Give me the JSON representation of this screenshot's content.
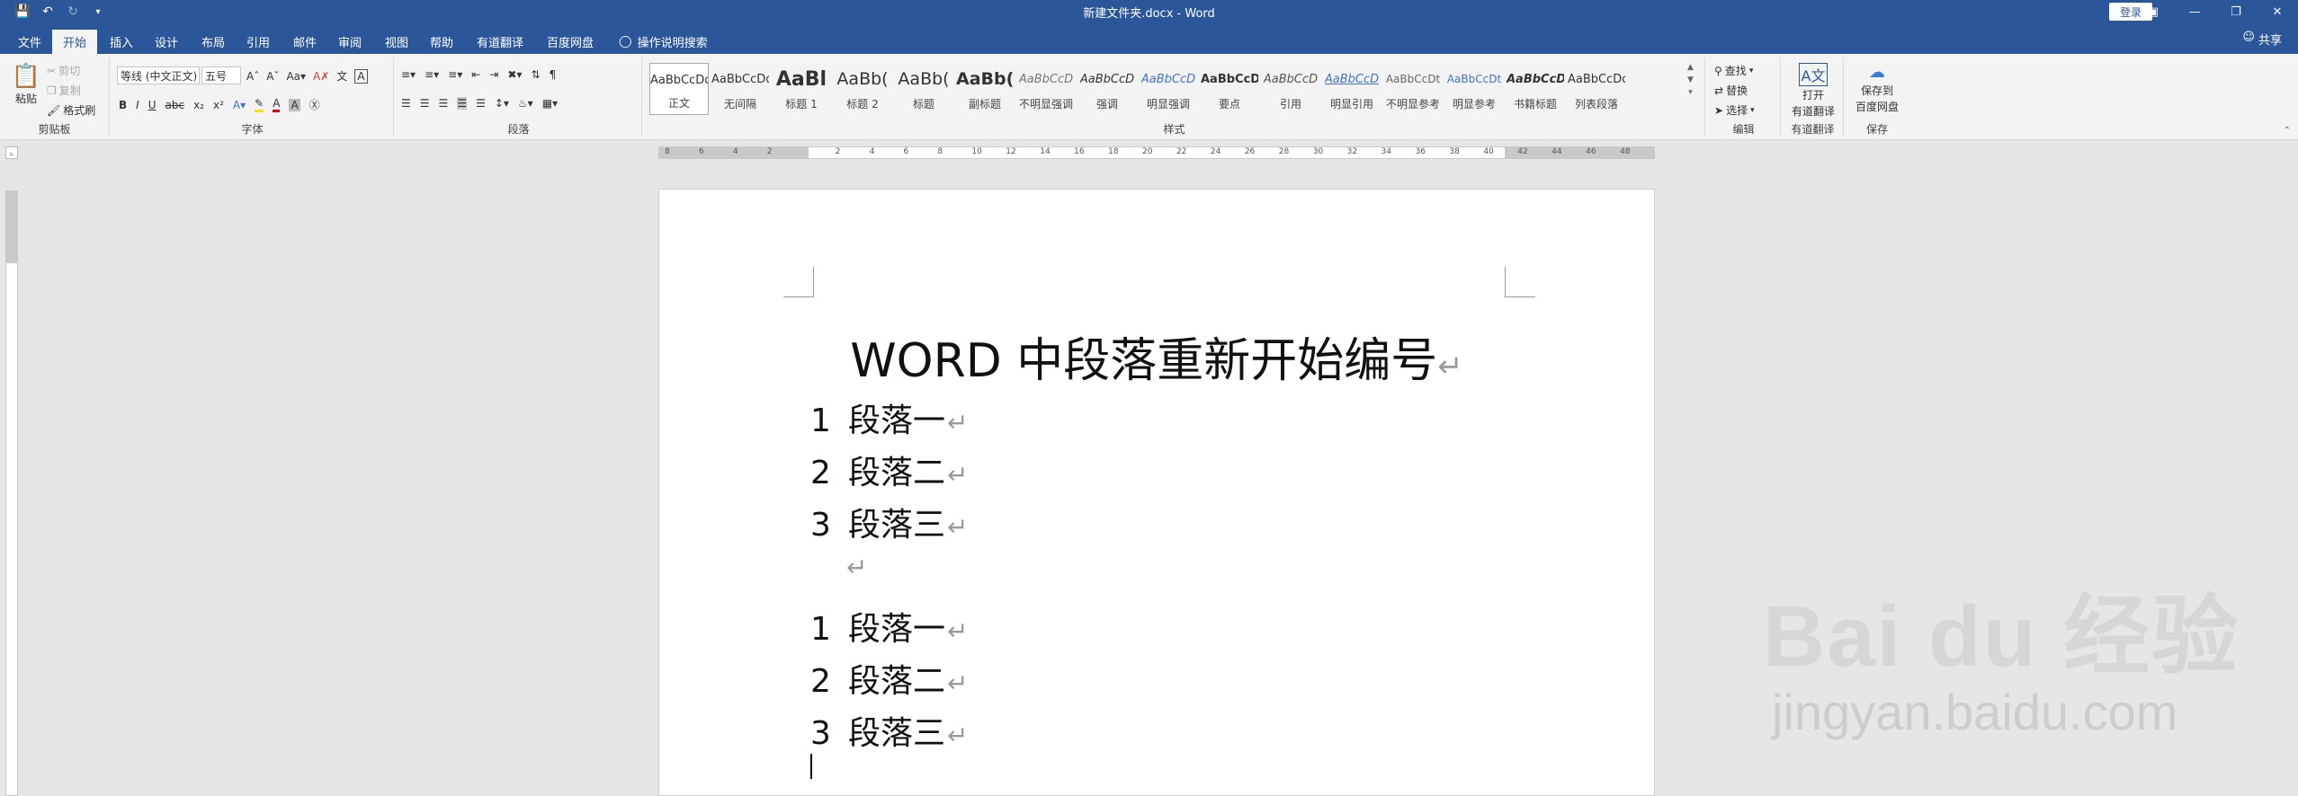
{
  "window": {
    "doc_title": "新建文件夹.docx - Word",
    "login_label": "登录",
    "share_label": "共享"
  },
  "tabs": [
    {
      "label": "文件"
    },
    {
      "label": "开始"
    },
    {
      "label": "插入"
    },
    {
      "label": "设计"
    },
    {
      "label": "布局"
    },
    {
      "label": "引用"
    },
    {
      "label": "邮件"
    },
    {
      "label": "审阅"
    },
    {
      "label": "视图"
    },
    {
      "label": "帮助"
    },
    {
      "label": "有道翻译"
    },
    {
      "label": "百度网盘"
    },
    {
      "label": "操作说明搜索"
    }
  ],
  "ribbon": {
    "clipboard": {
      "label": "剪贴板",
      "paste": "粘贴",
      "cut": "剪切",
      "copy": "复制",
      "format_painter": "格式刷"
    },
    "font": {
      "label": "字体",
      "font_name": "等线 (中文正文)",
      "font_size": "五号"
    },
    "paragraph": {
      "label": "段落"
    },
    "styles": {
      "label": "样式",
      "items": [
        {
          "sample": "AaBbCcDd",
          "name": "正文"
        },
        {
          "sample": "AaBbCcDd",
          "name": "无间隔"
        },
        {
          "sample": "AaBl",
          "name": "标题 1"
        },
        {
          "sample": "AaBb(",
          "name": "标题 2"
        },
        {
          "sample": "AaBb(",
          "name": "标题"
        },
        {
          "sample": "AaBb(",
          "name": "副标题"
        },
        {
          "sample": "AaBbCcD",
          "name": "不明显强调"
        },
        {
          "sample": "AaBbCcD",
          "name": "强调"
        },
        {
          "sample": "AaBbCcD",
          "name": "明显强调"
        },
        {
          "sample": "AaBbCcD",
          "name": "要点"
        },
        {
          "sample": "AaBbCcD",
          "name": "引用"
        },
        {
          "sample": "AaBbCcD",
          "name": "明显引用"
        },
        {
          "sample": "AaBbCcDt",
          "name": "不明显参考"
        },
        {
          "sample": "AaBbCcDt",
          "name": "明显参考"
        },
        {
          "sample": "AaBbCcD",
          "name": "书籍标题"
        },
        {
          "sample": "AaBbCcDd",
          "name": "列表段落"
        }
      ]
    },
    "editing": {
      "label": "编辑",
      "find": "查找",
      "replace": "替换",
      "select": "选择"
    },
    "youdao": {
      "label": "有道翻译",
      "open": "打开",
      "open2": "有道翻译"
    },
    "baidu": {
      "label": "保存",
      "save": "保存到",
      "save2": "百度网盘"
    }
  },
  "ruler": {
    "ticks": [
      "8",
      "6",
      "4",
      "2",
      "",
      "2",
      "4",
      "6",
      "8",
      "10",
      "12",
      "14",
      "16",
      "18",
      "20",
      "22",
      "24",
      "26",
      "28",
      "30",
      "32",
      "34",
      "36",
      "38",
      "40",
      "42",
      "44",
      "46",
      "48"
    ]
  },
  "document": {
    "heading": "WORD 中段落重新开始编号",
    "list1": [
      {
        "num": "1",
        "text": "段落一"
      },
      {
        "num": "2",
        "text": "段落二"
      },
      {
        "num": "3",
        "text": "段落三"
      }
    ],
    "list2": [
      {
        "num": "1",
        "text": "段落一"
      },
      {
        "num": "2",
        "text": "段落二"
      },
      {
        "num": "3",
        "text": "段落三"
      }
    ],
    "para_mark": "↵"
  },
  "watermark": {
    "logo": "Bai du 经验",
    "url": "jingyan.baidu.com"
  }
}
